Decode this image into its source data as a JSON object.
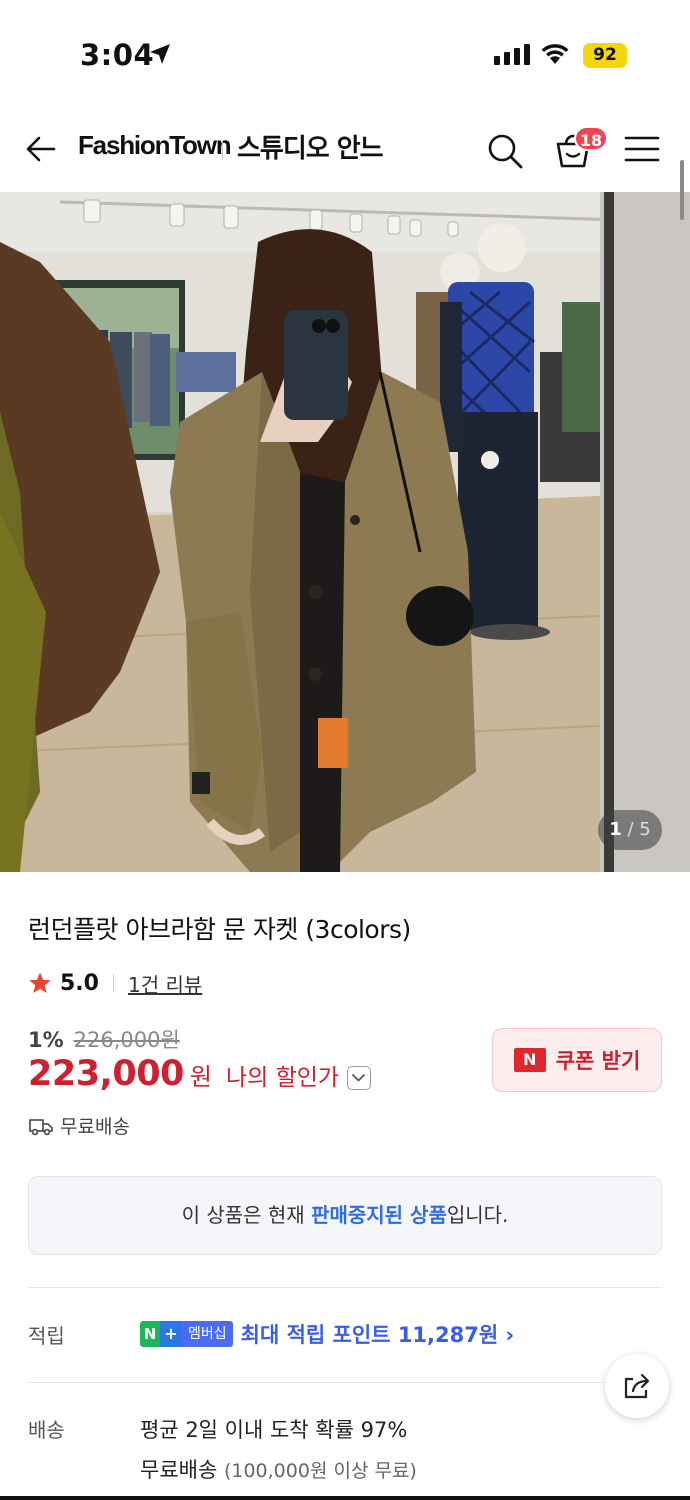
{
  "status_bar": {
    "time": "3:04",
    "battery": "92"
  },
  "nav": {
    "brand": "FashionTown",
    "shop_name": "스튜디오 안느",
    "cart_count": "18"
  },
  "gallery": {
    "current": "1",
    "separator": " / ",
    "total": "5"
  },
  "product": {
    "title": "런던플랏 아브라함 문 자켓 (3colors)",
    "rating": "5.0",
    "review_count": "1건 리뷰",
    "discount_rate": "1%",
    "original_price": "226,000원",
    "sale_price": "223,000",
    "currency": "원",
    "my_discount_label": "나의 할인가",
    "coupon_label": "쿠폰 받기",
    "coupon_badge": "N",
    "shipping": "무료배송"
  },
  "notice": {
    "prefix": "이 상품은 현재 ",
    "highlight": "판매중지된 상품",
    "suffix": "입니다."
  },
  "points": {
    "label": "적립",
    "badge_n": "N",
    "badge_plus": "+",
    "badge_member": "멤버십",
    "text": "최대 적립 포인트 11,287원 ›"
  },
  "delivery": {
    "label": "배송",
    "line1": "평균 2일 이내 도착 확률 97%",
    "line2": "무료배송",
    "line2_condition": "(100,000원 이상 무료)"
  },
  "colors": {
    "accent_red": "#d11f30",
    "link_blue": "#2f6ee0",
    "points_blue": "#3a5de8",
    "star": "#e8452e"
  }
}
